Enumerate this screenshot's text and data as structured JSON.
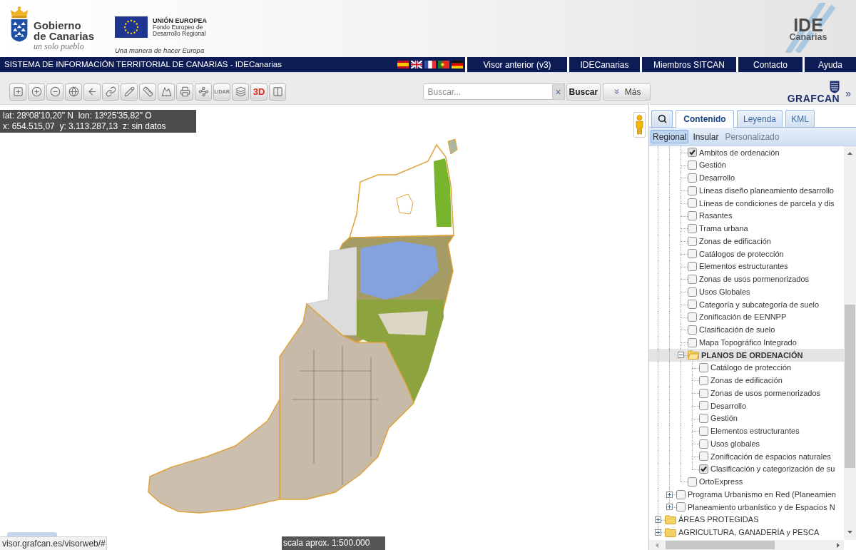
{
  "header": {
    "crest_lines": [
      "Gobierno",
      "de Canarias"
    ],
    "motto": "un solo pueblo",
    "eu_title": "UNIÓN EUROPEA",
    "eu_lines": [
      "Fondo Europeo de",
      "Desarrollo Regional"
    ],
    "eu_slogan": "Una manera de hacer Europa",
    "logo_title": "IDE",
    "logo_subtitle": "Canarias"
  },
  "nav": {
    "title": "SISTEMA DE INFORMACIÓN TERRITORIAL DE CANARIAS - IDECanarias",
    "links": [
      "Visor anterior (v3)",
      "IDECanarias",
      "Miembros SITCAN",
      "Contacto",
      "Ayuda"
    ]
  },
  "toolbar": {
    "buttons": [
      {
        "kind": "icon"
      },
      {
        "kind": "icon"
      },
      {
        "kind": "icon"
      },
      {
        "kind": "icon"
      },
      {
        "kind": "icon"
      },
      {
        "kind": "icon"
      },
      {
        "kind": "icon"
      },
      {
        "kind": "icon"
      },
      {
        "kind": "icon"
      },
      {
        "kind": "icon"
      },
      {
        "kind": "icon"
      },
      {
        "kind": "text",
        "label": "LIDAR",
        "disabled": true
      },
      {
        "kind": "icon"
      },
      {
        "kind": "text",
        "label": "3D",
        "disabled": false
      },
      {
        "kind": "icon"
      }
    ],
    "search": {
      "placeholder": "Buscar...",
      "clear": "×",
      "submit": "Buscar",
      "more": "Más"
    },
    "brand": "GRAFCAN",
    "collapse": "»"
  },
  "map": {
    "coordinates": [
      "lat: 28º08'10,20\" N  lon: 13º25'35,82\" O",
      "x: 654.515,07  y: 3.113.287,13  z: sin datos"
    ],
    "scale": "scala aprox. 1:500.000",
    "status_url": "visor.grafcan.es/visorweb/#"
  },
  "panel": {
    "tabs": [
      {
        "kind": "icon",
        "selected": false
      },
      {
        "kind": "text",
        "label": "Contenido",
        "selected": true
      },
      {
        "kind": "text",
        "label": "Leyenda",
        "selected": false
      },
      {
        "kind": "text",
        "label": "KML",
        "selected": false
      }
    ],
    "subtabs": [
      {
        "label": "Regional",
        "selected": true,
        "disabled": false
      },
      {
        "label": "Insular",
        "selected": false,
        "disabled": false
      },
      {
        "label": "Personalizado",
        "selected": false,
        "disabled": true
      }
    ],
    "tree": [
      {
        "children": [
          {
            "children": [
              {
                "kind": "layer",
                "label": "Ambitos de ordenación",
                "checked": true,
                "selected": false
              },
              {
                "kind": "layer",
                "label": "Gestión",
                "checked": false,
                "selected": false
              },
              {
                "kind": "layer",
                "label": "Desarrollo",
                "checked": false,
                "selected": false
              },
              {
                "kind": "layer",
                "label": "Líneas diseño planeamiento desarrollo",
                "checked": false,
                "selected": false
              },
              {
                "kind": "layer",
                "label": "Líneas de condiciones de parcela y dis",
                "checked": false,
                "selected": false
              },
              {
                "kind": "layer",
                "label": "Rasantes",
                "checked": false,
                "selected": false
              },
              {
                "kind": "layer",
                "label": "Trama urbana",
                "checked": false,
                "selected": false
              },
              {
                "kind": "layer",
                "label": "Zonas de edificación",
                "checked": false,
                "selected": false
              },
              {
                "kind": "layer",
                "label": "Catálogos de protección",
                "checked": false,
                "selected": false
              },
              {
                "kind": "layer",
                "label": "Elementos estructurantes",
                "checked": false,
                "selected": false
              },
              {
                "kind": "layer",
                "label": "Zonas de usos pormenorizados",
                "checked": false,
                "selected": false
              },
              {
                "kind": "layer",
                "label": "Usos Globales",
                "checked": false,
                "selected": false
              },
              {
                "kind": "layer",
                "label": "Categoría y subcategoría de suelo",
                "checked": false,
                "selected": false
              },
              {
                "kind": "layer",
                "label": "Zonificación de EENNPP",
                "checked": false,
                "selected": false
              },
              {
                "kind": "layer",
                "label": "Clasificación de suelo",
                "checked": false,
                "selected": false
              },
              {
                "kind": "layer",
                "label": "Mapa Topográfico Integrado",
                "checked": false,
                "selected": false
              },
              {
                "kind": "folder",
                "label": "PLANOS DE ORDENACIÓN",
                "expanded": true,
                "selected": true,
                "children": [
                  {
                    "kind": "layer",
                    "label": "Catálogo de protección",
                    "checked": false,
                    "selected": false
                  },
                  {
                    "kind": "layer",
                    "label": "Zonas de edificación",
                    "checked": false,
                    "selected": false
                  },
                  {
                    "kind": "layer",
                    "label": "Zonas de usos pormenorizados",
                    "checked": false,
                    "selected": false
                  },
                  {
                    "kind": "layer",
                    "label": "Desarrollo",
                    "checked": false,
                    "selected": false
                  },
                  {
                    "kind": "layer",
                    "label": "Gestión",
                    "checked": false,
                    "selected": false
                  },
                  {
                    "kind": "layer",
                    "label": "Elementos estructurantes",
                    "checked": false,
                    "selected": false
                  },
                  {
                    "kind": "layer",
                    "label": "Usos globales",
                    "checked": false,
                    "selected": false
                  },
                  {
                    "kind": "layer",
                    "label": "Zonificación de espacios naturales",
                    "checked": false,
                    "selected": false
                  },
                  {
                    "kind": "layer",
                    "label": "Clasificación y categorización de su",
                    "checked": true,
                    "selected": false
                  }
                ]
              },
              {
                "kind": "layer",
                "label": "OrtoExpress",
                "checked": false,
                "selected": false
              }
            ]
          },
          {
            "kind": "group",
            "label": "Programa Urbanismo en Red (Planeamien",
            "expanded": false,
            "checked": false,
            "selected": false
          },
          {
            "kind": "group",
            "label": "Planeamiento urbanístico y de Espacios N",
            "expanded": false,
            "checked": false,
            "selected": false
          }
        ]
      },
      {
        "kind": "folder",
        "label": "ÁREAS PROTEGIDAS",
        "expanded": false,
        "selected": false
      },
      {
        "kind": "folder",
        "label": "AGRICULTURA, GANADERÍA y PESCA",
        "expanded": false,
        "selected": false
      }
    ]
  }
}
